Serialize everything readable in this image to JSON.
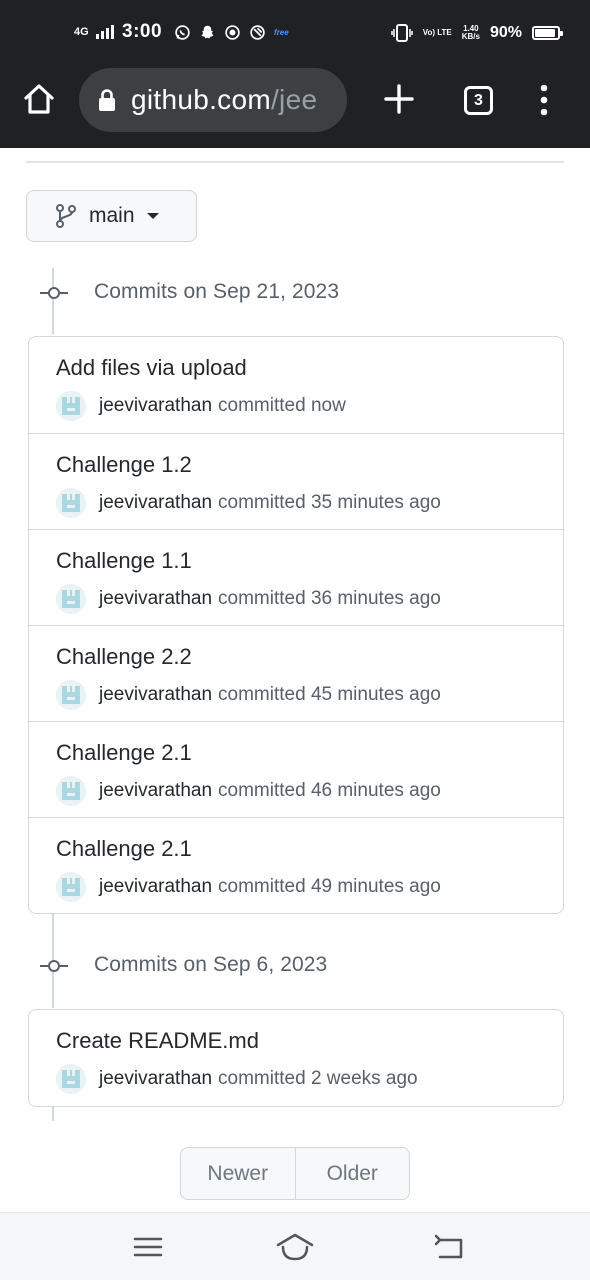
{
  "status_bar": {
    "network_type": "4G",
    "time": "3:00",
    "volte": "Vo) LTE",
    "speed_value": "1.40",
    "speed_unit": "KB/s",
    "battery_pct": "90%",
    "battery_level": 0.9,
    "free_badge": "free"
  },
  "browser": {
    "url_host": "github.com",
    "url_path": "/jee",
    "tab_count": "3"
  },
  "branch": {
    "label": "main"
  },
  "commit_groups": [
    {
      "header": "Commits on Sep 21, 2023",
      "commits": [
        {
          "title": "Add files via upload",
          "author": "jeevivarathan",
          "time": "committed now"
        },
        {
          "title": "Challenge 1.2",
          "author": "jeevivarathan",
          "time": "committed 35 minutes ago"
        },
        {
          "title": "Challenge 1.1",
          "author": "jeevivarathan",
          "time": "committed 36 minutes ago"
        },
        {
          "title": "Challenge 2.2",
          "author": "jeevivarathan",
          "time": "committed 45 minutes ago"
        },
        {
          "title": "Challenge 2.1",
          "author": "jeevivarathan",
          "time": "committed 46 minutes ago"
        },
        {
          "title": "Challenge 2.1",
          "author": "jeevivarathan",
          "time": "committed 49 minutes ago"
        }
      ]
    },
    {
      "header": "Commits on Sep 6, 2023",
      "commits": [
        {
          "title": "Create README.md",
          "author": "jeevivarathan",
          "time": "committed 2 weeks ago"
        }
      ]
    }
  ],
  "pagination": {
    "newer": "Newer",
    "older": "Older"
  },
  "colors": {
    "chrome_dark": "#202124",
    "url_pill": "#3c4043",
    "border": "#d0d7de",
    "muted_text": "#57606a",
    "text": "#24292f"
  }
}
